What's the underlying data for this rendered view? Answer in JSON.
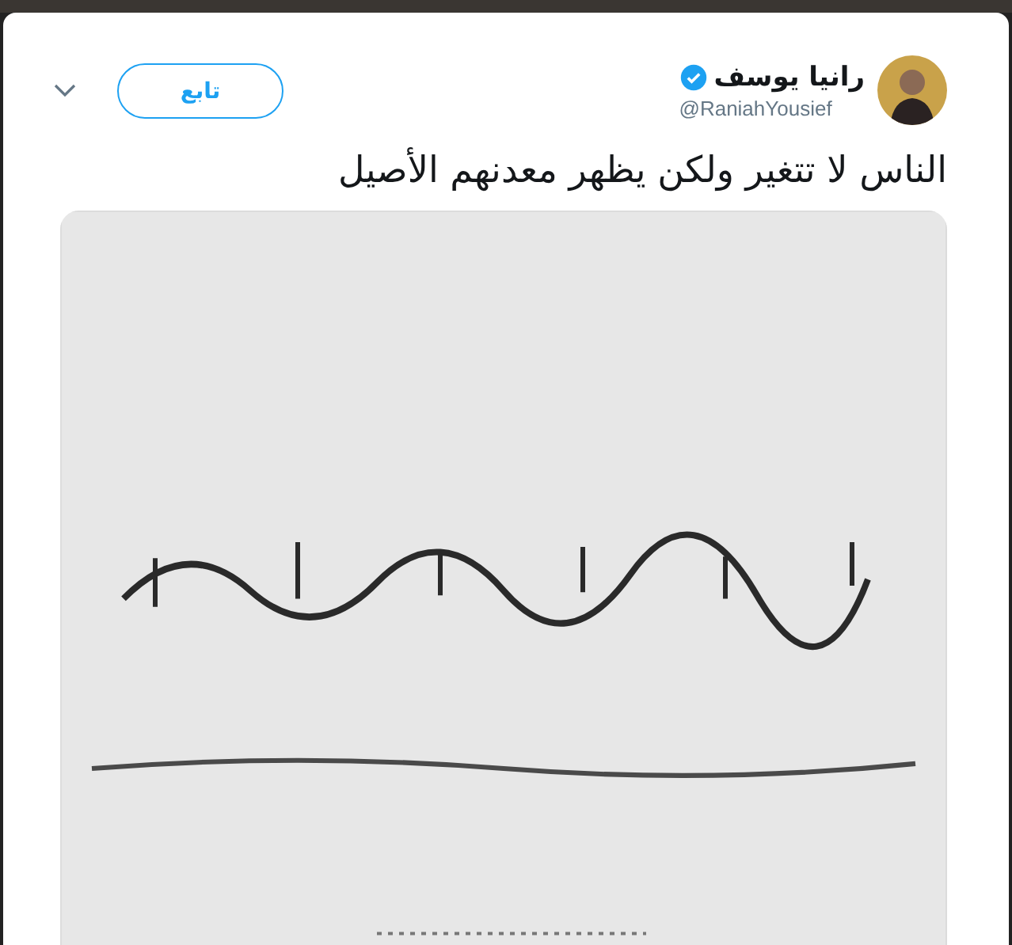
{
  "tweet": {
    "author": {
      "name": "رانيا يوسف",
      "verified": true,
      "handle": "@RaniahYousief"
    },
    "follow_button": "تابع",
    "text": "الناس لا تتغير ولكن يظهر معدنهم الأصيل"
  }
}
